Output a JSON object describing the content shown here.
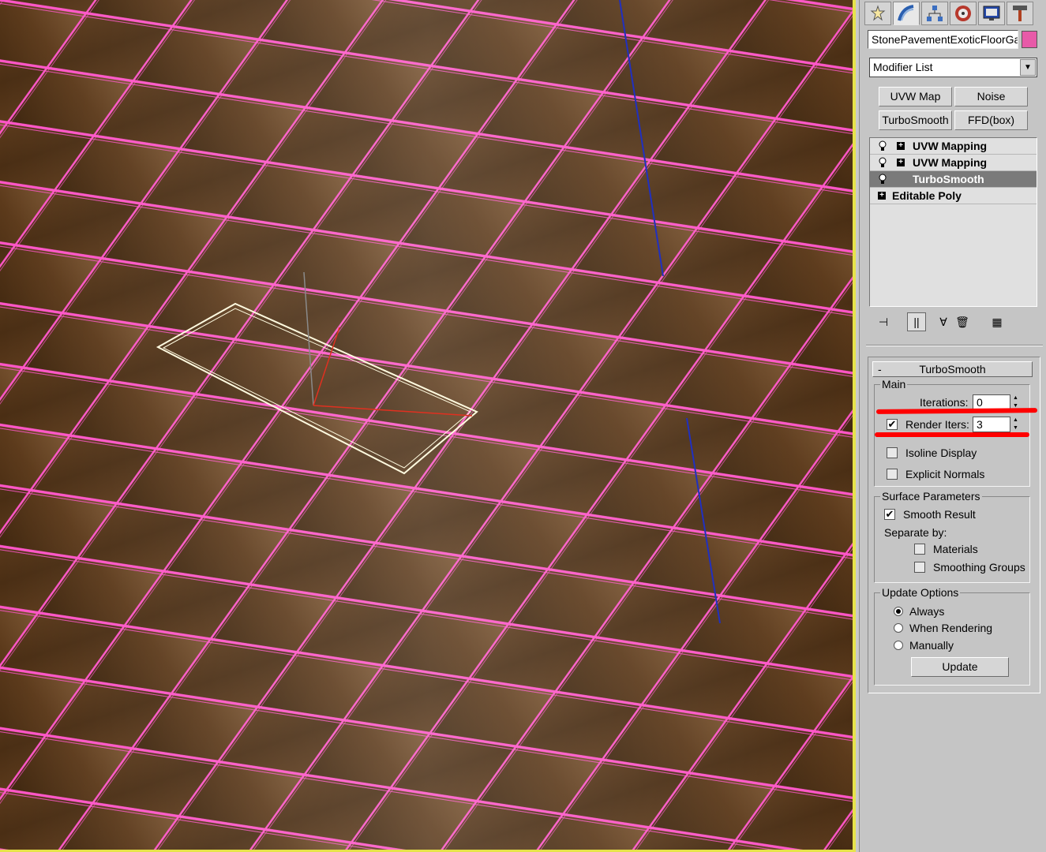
{
  "panel": {
    "tabs": [
      {
        "icon": "create-icon"
      },
      {
        "icon": "modify-icon"
      },
      {
        "icon": "hierarchy-icon"
      },
      {
        "icon": "motion-icon"
      },
      {
        "icon": "display-icon"
      },
      {
        "icon": "utilities-icon"
      }
    ],
    "object_name": "StonePavementExoticFloorGa",
    "object_color": "#e75aa8",
    "modifier_list": "Modifier List",
    "quick_buttons": [
      "UVW Map",
      "Noise",
      "TurboSmooth",
      "FFD(box)"
    ],
    "stack": [
      {
        "label": "UVW Mapping"
      },
      {
        "label": "UVW Mapping"
      },
      {
        "label": "TurboSmooth"
      },
      {
        "label": "Editable Poly"
      }
    ]
  },
  "turbosmooth": {
    "title": "TurboSmooth",
    "collapse": "-",
    "main": {
      "group": "Main",
      "iterations_label": "Iterations:",
      "iterations_value": "0",
      "render_iters_label": "Render Iters:",
      "render_iters_value": "3",
      "isoline": "Isoline Display",
      "explicit_normals": "Explicit Normals"
    },
    "surface": {
      "group": "Surface Parameters",
      "smooth_result": "Smooth Result",
      "separate_by": "Separate by:",
      "materials": "Materials",
      "smoothing_groups": "Smoothing Groups"
    },
    "update": {
      "group": "Update Options",
      "always": "Always",
      "when_rendering": "When Rendering",
      "manually": "Manually",
      "button": "Update"
    }
  }
}
